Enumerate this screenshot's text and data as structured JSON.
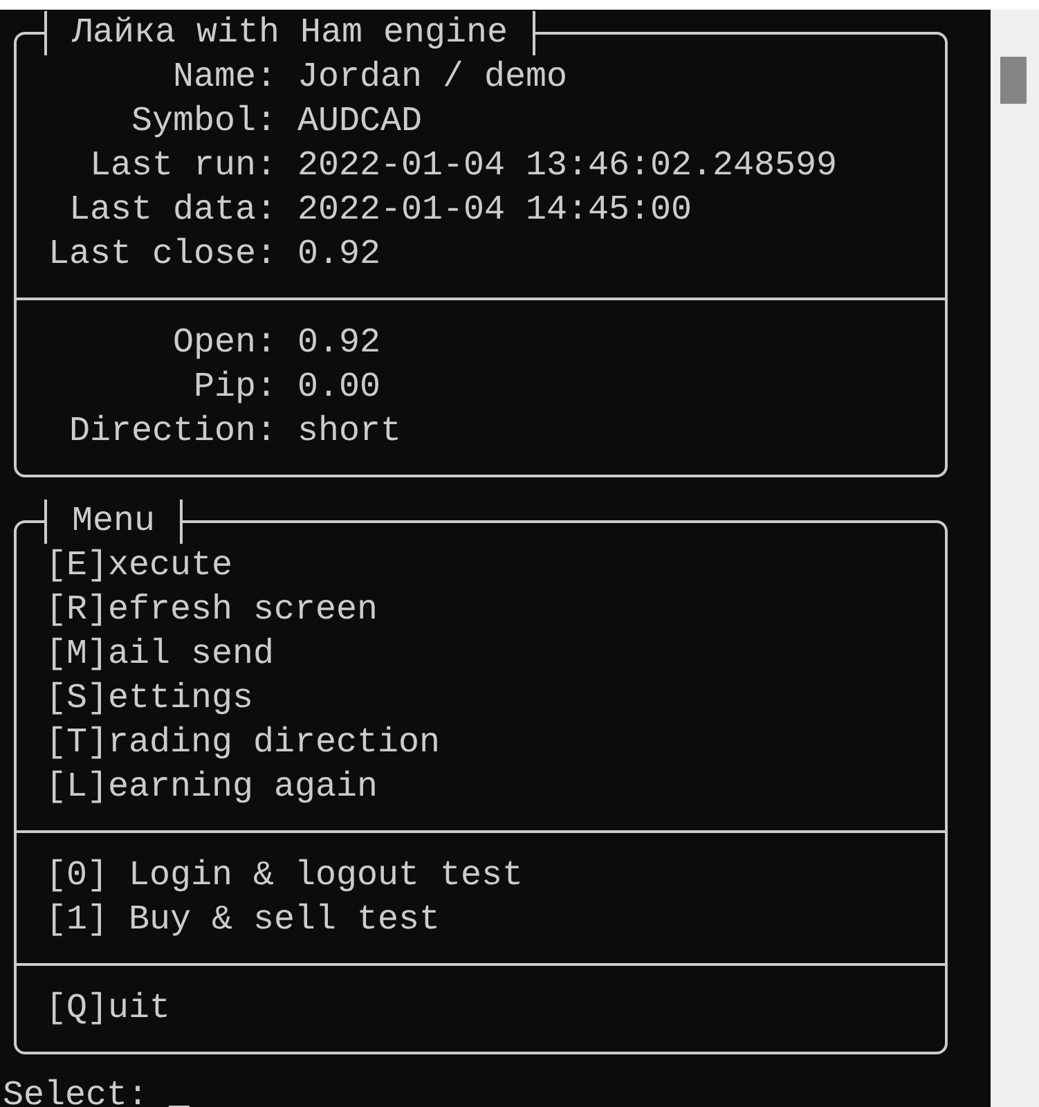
{
  "info_panel": {
    "title": "Лайка with Ham engine",
    "sections": [
      [
        {
          "label": "Name:",
          "value": "Jordan / demo"
        },
        {
          "label": "Symbol:",
          "value": "AUDCAD"
        },
        {
          "label": "Last run:",
          "value": "2022-01-04 13:46:02.248599"
        },
        {
          "label": "Last data:",
          "value": "2022-01-04 14:45:00"
        },
        {
          "label": "Last close:",
          "value": "0.92"
        }
      ],
      [
        {
          "label": "Open:",
          "value": "0.92"
        },
        {
          "label": "Pip:",
          "value": "0.00"
        },
        {
          "label": "Direction:",
          "value": "short"
        }
      ]
    ]
  },
  "menu_panel": {
    "title": "Menu",
    "sections": [
      [
        "[E]xecute",
        "[R]efresh screen",
        "[M]ail send",
        "[S]ettings",
        "[T]rading direction",
        "[L]earning again"
      ],
      [
        "[0] Login & logout test",
        "[1] Buy & sell test"
      ],
      [
        "[Q]uit"
      ]
    ]
  },
  "prompt": {
    "label": "Select:"
  }
}
